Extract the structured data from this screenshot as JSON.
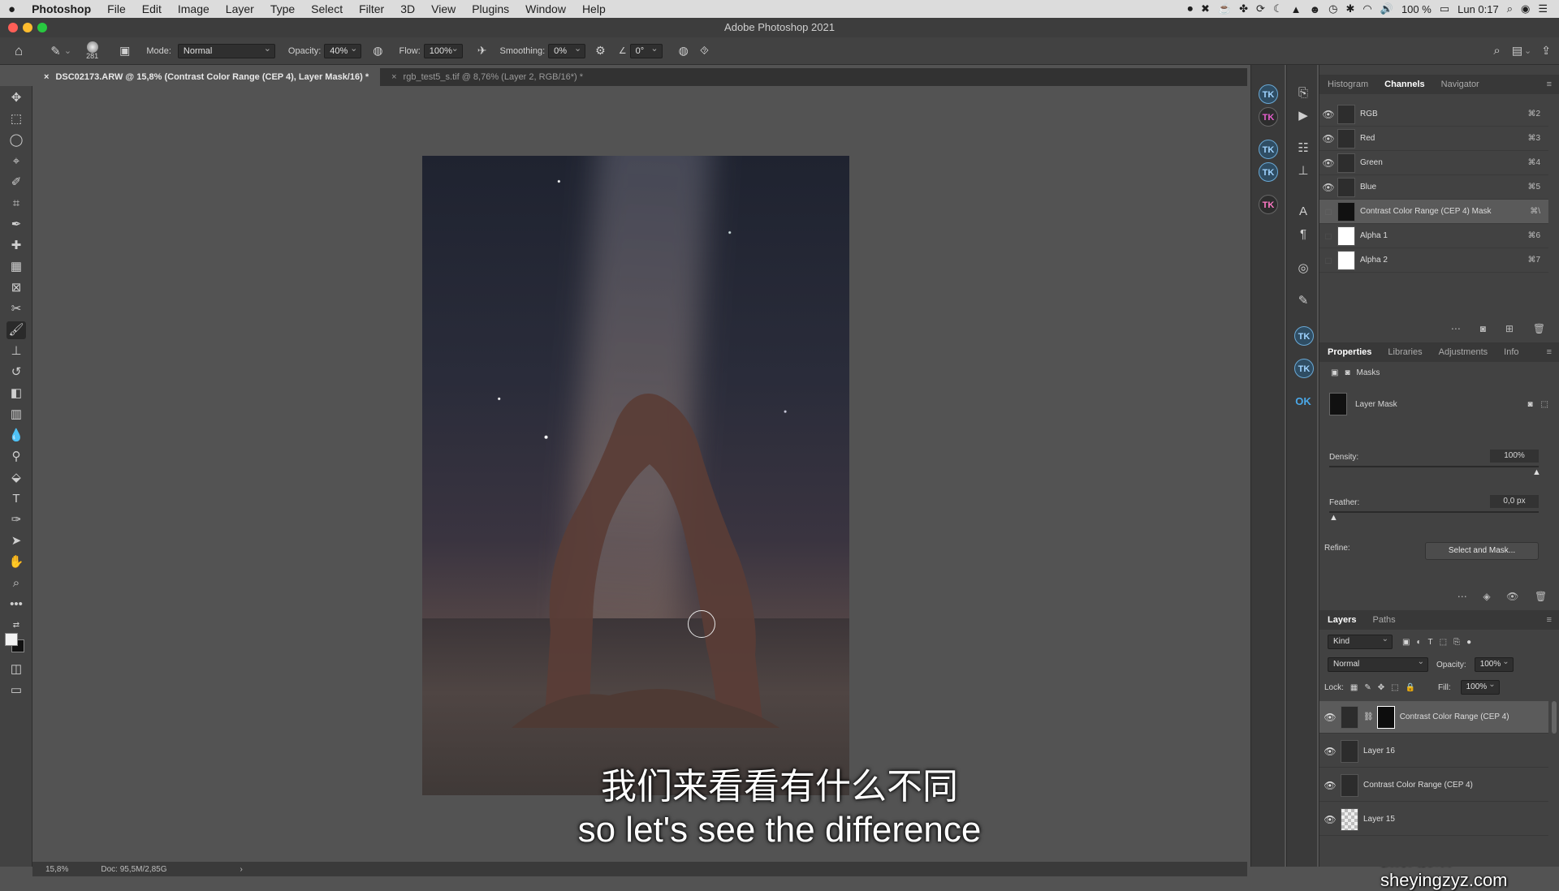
{
  "menubar": {
    "apple": "",
    "app": "Photoshop",
    "items": [
      "File",
      "Edit",
      "Image",
      "Layer",
      "Type",
      "Select",
      "Filter",
      "3D",
      "View",
      "Plugins",
      "Window",
      "Help"
    ],
    "battery": "100 %",
    "clock": "Lun 0:17"
  },
  "window": {
    "title": "Adobe Photoshop 2021"
  },
  "options": {
    "brush_size": "281",
    "mode_label": "Mode:",
    "mode": "Normal",
    "opacity_label": "Opacity:",
    "opacity": "40%",
    "flow_label": "Flow:",
    "flow": "100%",
    "smoothing_label": "Smoothing:",
    "smoothing": "0%",
    "angle": "0°"
  },
  "tabs": [
    {
      "label": "DSC02173.ARW @ 15,8% (Contrast Color Range (CEP 4), Layer Mask/16) *"
    },
    {
      "label": "rgb_test5_s.tif @ 8,76% (Layer 2, RGB/16*) *"
    }
  ],
  "status": {
    "zoom": "15,8%",
    "doc": "Doc: 95,5M/2,85G"
  },
  "subtitles": {
    "zh": "我们来看看有什么不同",
    "en": "so let's see the difference"
  },
  "watermark": "摄影前沿 sheyingzyz.com",
  "channels_panel": {
    "tabs": [
      "Histogram",
      "Channels",
      "Navigator"
    ],
    "rows": [
      {
        "name": "RGB",
        "shortcut": "⌘2"
      },
      {
        "name": "Red",
        "shortcut": "⌘3"
      },
      {
        "name": "Green",
        "shortcut": "⌘4"
      },
      {
        "name": "Blue",
        "shortcut": "⌘5"
      },
      {
        "name": "Contrast Color Range (CEP 4) Mask",
        "shortcut": "⌘\\"
      },
      {
        "name": "Alpha 1",
        "shortcut": "⌘6"
      },
      {
        "name": "Alpha 2",
        "shortcut": "⌘7"
      }
    ]
  },
  "properties_panel": {
    "tabs": [
      "Properties",
      "Libraries",
      "Adjustments",
      "Info"
    ],
    "masks_label": "Masks",
    "layer_mask_label": "Layer Mask",
    "density_label": "Density:",
    "density": "100%",
    "feather_label": "Feather:",
    "feather": "0,0 px",
    "refine_label": "Refine:",
    "select_mask_button": "Select and Mask..."
  },
  "layers_panel": {
    "tabs": [
      "Layers",
      "Paths"
    ],
    "kind": "Kind",
    "blend": "Normal",
    "opacity_label": "Opacity:",
    "opacity": "100%",
    "lock_label": "Lock:",
    "fill_label": "Fill:",
    "fill": "100%",
    "layers": [
      {
        "name": "Contrast Color Range (CEP 4)"
      },
      {
        "name": "Layer 16"
      },
      {
        "name": "Contrast Color Range (CEP 4)"
      },
      {
        "name": "Layer 15"
      }
    ]
  },
  "plugin_icons": {
    "tk_label": "TK",
    "ok_label": "OK"
  }
}
